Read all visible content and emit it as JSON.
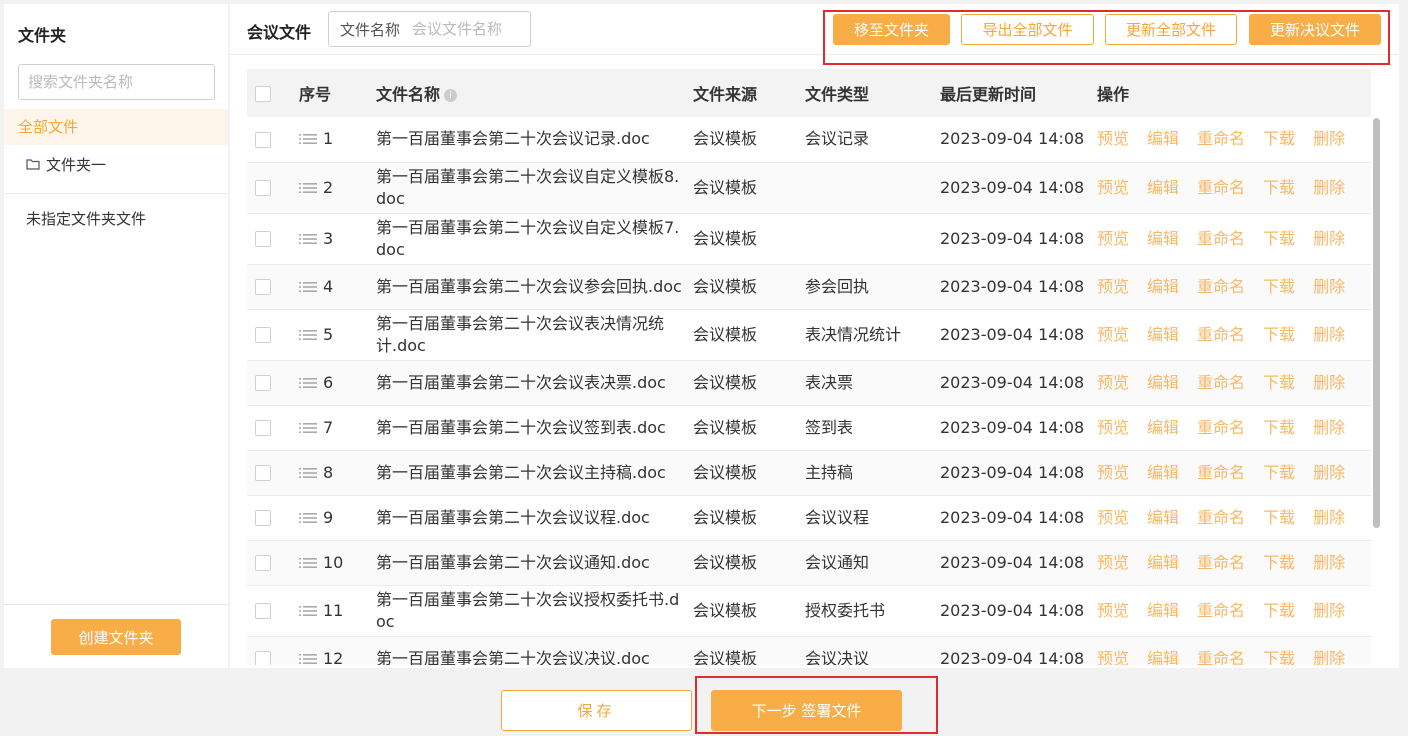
{
  "sidebar": {
    "title": "文件夹",
    "search_placeholder": "搜索文件夹名称",
    "all_files": "全部文件",
    "folder_one": "文件夹一",
    "unassigned": "未指定文件夹文件",
    "create_button": "创建文件夹",
    "icon": "folder-icon"
  },
  "main": {
    "title": "会议文件",
    "filter_label": "文件名称",
    "filter_placeholder": "会议文件名称"
  },
  "toolbar": {
    "move_to_folder": "移至文件夹",
    "export_all": "导出全部文件",
    "update_all": "更新全部文件",
    "update_resolution": "更新决议文件"
  },
  "table": {
    "headers": {
      "index": "序号",
      "name": "文件名称",
      "source": "文件来源",
      "type": "文件类型",
      "updated": "最后更新时间",
      "actions": "操作"
    },
    "actions": [
      "预览",
      "编辑",
      "重命名",
      "下载",
      "删除"
    ],
    "rows": [
      {
        "index": "1",
        "name": "第一百届董事会第二十次会议记录.doc",
        "source": "会议模板",
        "type": "会议记录",
        "updated": "2023-09-04 14:08"
      },
      {
        "index": "2",
        "name": "第一百届董事会第二十次会议自定义模板8.doc",
        "source": "会议模板",
        "type": "",
        "updated": "2023-09-04 14:08"
      },
      {
        "index": "3",
        "name": "第一百届董事会第二十次会议自定义模板7.doc",
        "source": "会议模板",
        "type": "",
        "updated": "2023-09-04 14:08"
      },
      {
        "index": "4",
        "name": "第一百届董事会第二十次会议参会回执.doc",
        "source": "会议模板",
        "type": "参会回执",
        "updated": "2023-09-04 14:08"
      },
      {
        "index": "5",
        "name": "第一百届董事会第二十次会议表决情况统计.doc",
        "source": "会议模板",
        "type": "表决情况统计",
        "updated": "2023-09-04 14:08"
      },
      {
        "index": "6",
        "name": "第一百届董事会第二十次会议表决票.doc",
        "source": "会议模板",
        "type": "表决票",
        "updated": "2023-09-04 14:08"
      },
      {
        "index": "7",
        "name": "第一百届董事会第二十次会议签到表.doc",
        "source": "会议模板",
        "type": "签到表",
        "updated": "2023-09-04 14:08"
      },
      {
        "index": "8",
        "name": "第一百届董事会第二十次会议主持稿.doc",
        "source": "会议模板",
        "type": "主持稿",
        "updated": "2023-09-04 14:08"
      },
      {
        "index": "9",
        "name": "第一百届董事会第二十次会议议程.doc",
        "source": "会议模板",
        "type": "会议议程",
        "updated": "2023-09-04 14:08"
      },
      {
        "index": "10",
        "name": "第一百届董事会第二十次会议通知.doc",
        "source": "会议模板",
        "type": "会议通知",
        "updated": "2023-09-04 14:08"
      },
      {
        "index": "11",
        "name": "第一百届董事会第二十次会议授权委托书.doc",
        "source": "会议模板",
        "type": "授权委托书",
        "updated": "2023-09-04 14:08"
      },
      {
        "index": "12",
        "name": "第一百届董事会第二十次会议决议.doc",
        "source": "会议模板",
        "type": "会议决议",
        "updated": "2023-09-04 14:08"
      }
    ]
  },
  "footer": {
    "save": "保存",
    "next": "下一步 签署文件"
  },
  "colors": {
    "accent": "#f8ad47",
    "highlight_border": "#e02c2c"
  }
}
